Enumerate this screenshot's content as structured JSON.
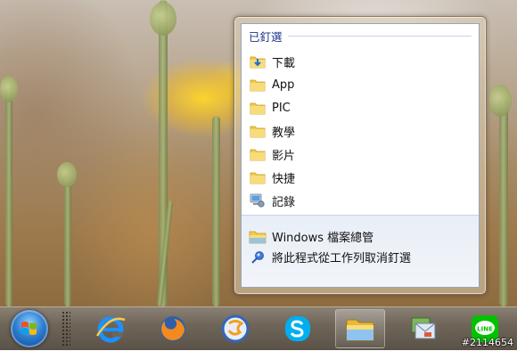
{
  "jump_list": {
    "section_title": "已釘選",
    "pinned_items": [
      {
        "label": "下載",
        "icon": "download-folder-icon"
      },
      {
        "label": "App",
        "icon": "folder-icon"
      },
      {
        "label": "PIC",
        "icon": "folder-icon"
      },
      {
        "label": "教學",
        "icon": "folder-icon"
      },
      {
        "label": "影片",
        "icon": "folder-icon"
      },
      {
        "label": "快捷",
        "icon": "folder-icon"
      },
      {
        "label": "記錄",
        "icon": "computer-icon"
      }
    ],
    "tasks": [
      {
        "label": "Windows 檔案總管",
        "icon": "explorer-icon"
      },
      {
        "label": "將此程式從工作列取消釘選",
        "icon": "unpin-icon"
      }
    ]
  },
  "taskbar": {
    "buttons": [
      {
        "name": "internet-explorer-icon",
        "active": false
      },
      {
        "name": "firefox-icon",
        "active": false
      },
      {
        "name": "app-circle-icon",
        "active": false
      },
      {
        "name": "skype-icon",
        "active": false
      },
      {
        "name": "file-explorer-icon",
        "active": true
      },
      {
        "name": "mail-app-icon",
        "active": false
      },
      {
        "name": "line-icon",
        "active": false
      }
    ]
  },
  "watermark": "#2114654",
  "colors": {
    "jump_header_text": "#1e3287",
    "folder_yellow": "#f2c94c",
    "ie_blue": "#1e90ff",
    "skype_blue": "#00aff0",
    "line_green": "#00c300"
  }
}
